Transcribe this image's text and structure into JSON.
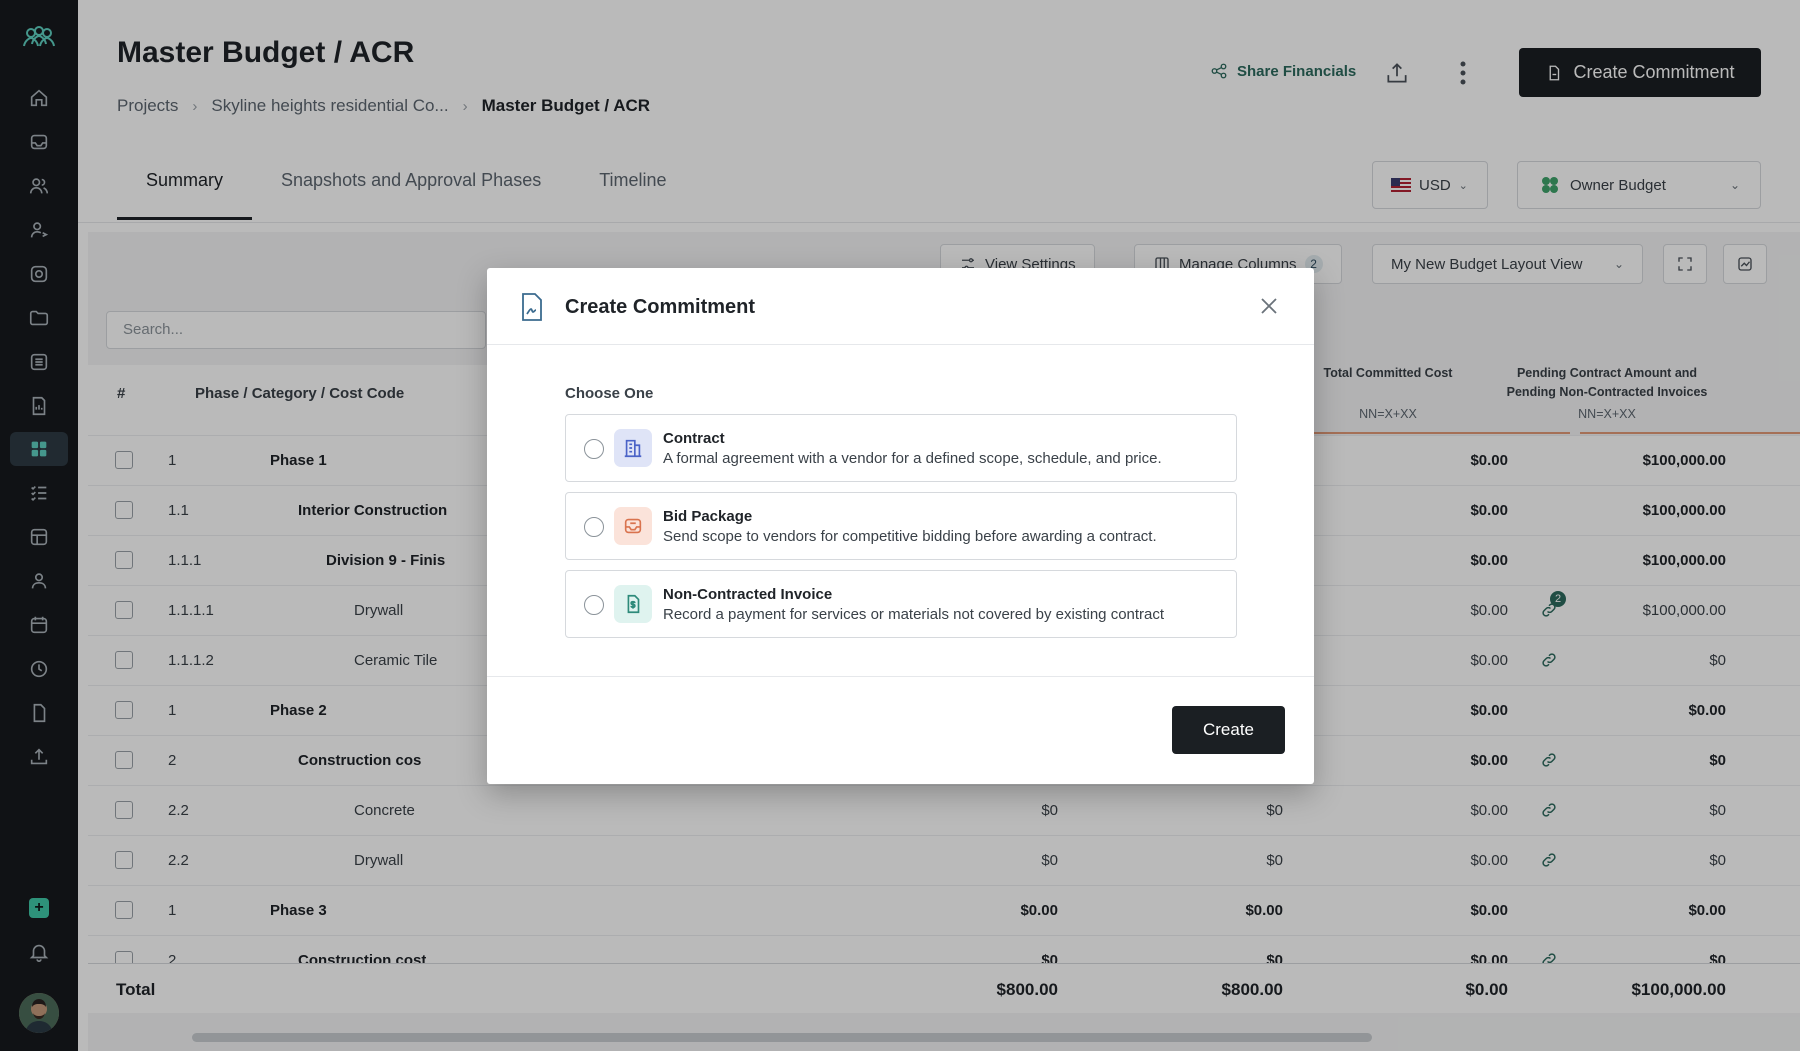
{
  "header": {
    "title": "Master Budget / ACR",
    "breadcrumb": [
      "Projects",
      "Skyline heights residential Co...",
      "Master Budget / ACR"
    ],
    "share_label": "Share Financials",
    "create_commitment_label": "Create Commitment"
  },
  "tabs": [
    {
      "label": "Summary"
    },
    {
      "label": "Snapshots and Approval Phases"
    },
    {
      "label": "Timeline"
    }
  ],
  "currency": {
    "label": "USD"
  },
  "budget_select": {
    "label": "Owner Budget"
  },
  "toolbar": {
    "view_settings": "View Settings",
    "manage_columns": "Manage Columns",
    "manage_columns_count": "2",
    "layout_view": "My New Budget Layout View"
  },
  "search": {
    "placeholder": "Search..."
  },
  "table": {
    "headers": {
      "num": "#",
      "phase": "Phase / Category / Cost Code"
    },
    "columns": [
      {
        "title": "Total Committed Cost",
        "formula": "NN=X+XX"
      },
      {
        "title": "Pending Contract Amount and Pending Non-Contracted Invoices",
        "formula": "NN=X+XX"
      }
    ],
    "rows": [
      {
        "num": "1",
        "name": "Phase 1",
        "col1": "",
        "col2": "",
        "committed": "$0.00",
        "pending": "$100,000.00"
      },
      {
        "num": "1.1",
        "name": "Interior Construction",
        "col1": "",
        "col2": "",
        "committed": "$0.00",
        "pending": "$100,000.00"
      },
      {
        "num": "1.1.1",
        "name": "Division 9 - Finis",
        "col1": "",
        "col2": "",
        "committed": "$0.00",
        "pending": "$100,000.00"
      },
      {
        "num": "1.1.1.1",
        "name": "Drywall",
        "col1": "",
        "col2": "",
        "committed": "$0.00",
        "pending": "$100,000.00",
        "pending_badge": "2"
      },
      {
        "num": "1.1.1.2",
        "name": "Ceramic Tile",
        "col1": "",
        "col2": "",
        "committed": "$0.00",
        "pending": "$0"
      },
      {
        "num": "1",
        "name": "Phase 2",
        "col1": "",
        "col2": "",
        "committed": "$0.00",
        "pending": "$0.00"
      },
      {
        "num": "2",
        "name": "Construction cos",
        "col1": "",
        "col2": "",
        "committed": "$0.00",
        "pending": "$0"
      },
      {
        "num": "2.2",
        "name": "Concrete",
        "col1": "$0",
        "col2": "$0",
        "committed": "$0.00",
        "pending": "$0"
      },
      {
        "num": "2.2",
        "name": "Drywall",
        "col1": "$0",
        "col2": "$0",
        "committed": "$0.00",
        "pending": "$0"
      },
      {
        "num": "1",
        "name": "Phase 3",
        "col1": "$0.00",
        "col2": "$0.00",
        "committed": "$0.00",
        "pending": "$0.00"
      },
      {
        "num": "2",
        "name": "Construction cost",
        "col1": "$0",
        "col2": "$0",
        "committed": "$0.00",
        "pending": "$0"
      }
    ],
    "total": {
      "label": "Total",
      "col1": "$800.00",
      "col2": "$800.00",
      "committed": "$0.00",
      "pending": "$100,000.00"
    }
  },
  "modal": {
    "title": "Create Commitment",
    "choose_label": "Choose One",
    "options": [
      {
        "title": "Contract",
        "description": "A formal agreement with a vendor for a defined scope, schedule, and price.",
        "icon": "building-icon",
        "color": "#dfe4f7"
      },
      {
        "title": "Bid Package",
        "description": "Send scope to vendors for competitive bidding before awarding a contract.",
        "icon": "inbox-icon",
        "color": "#fbe3da"
      },
      {
        "title": "Non-Contracted Invoice",
        "description": "Record a payment for services or materials not covered by existing contract",
        "icon": "invoice-icon",
        "color": "#dff3ef"
      }
    ],
    "create_label": "Create"
  },
  "colors": {
    "sidebar_bg": "#161a1e",
    "primary_btn": "#1b1f23",
    "accent_green": "#2d6a5e",
    "accent_orange": "#e29a78"
  }
}
